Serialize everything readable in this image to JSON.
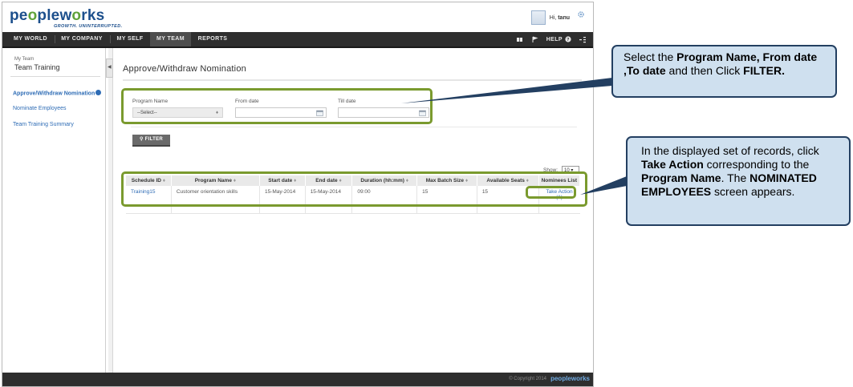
{
  "header": {
    "logo_text_left": "pe",
    "logo_text_o": "o",
    "logo_text_mid": "plew",
    "logo_text_o2": "o",
    "logo_text_right": "rks",
    "tagline": "GROWTH. UNINTERRUPTED.",
    "greeting_prefix": "Hi,",
    "user_name": "tanu"
  },
  "nav": {
    "items": [
      {
        "label": "MY WORLD"
      },
      {
        "label": "MY COMPANY"
      },
      {
        "label": "MY SELF"
      },
      {
        "label": "MY TEAM",
        "active": true
      },
      {
        "label": "REPORTS"
      }
    ],
    "help_label": "HELP"
  },
  "sidebar": {
    "crumb": "My Team",
    "title": "Team Training",
    "links": [
      {
        "label": "Approve/Withdraw Nomination",
        "active": true
      },
      {
        "label": "Nominate Employees"
      },
      {
        "label": "Team Training Summary"
      }
    ]
  },
  "main": {
    "title": "Approve/Withdraw Nomination",
    "filters": {
      "program_name_label": "Program Name",
      "program_name_value": "--Select--",
      "from_date_label": "From date",
      "till_date_label": "Till date",
      "filter_button": "FILTER"
    },
    "show_label": "Show:",
    "show_value": "10",
    "table": {
      "columns": [
        "Schedule ID",
        "Program Name",
        "Start date",
        "End date",
        "Duration (hh:mm)",
        "Max Batch Size",
        "Available Seats",
        "Nominees List"
      ],
      "rows": [
        {
          "schedule_id": "Training15",
          "program_name": "Customer orientation skills",
          "start_date": "15-May-2014",
          "end_date": "15-May-2014",
          "duration": "09:00",
          "max_batch": "15",
          "available_seats": "15",
          "nominees": "Take Action (1)"
        }
      ]
    }
  },
  "footer": {
    "copyright": "© Copyright 2014",
    "logo": "peopleworks"
  },
  "callouts": {
    "filter": {
      "t1": "Select the ",
      "b1": "Program Name, From date ,To date",
      "t2": " and then Click ",
      "b2": "FILTER."
    },
    "action": {
      "t1": "In the displayed set of records, click ",
      "b1": "Take Action",
      "t2": " corresponding to the ",
      "b2": "Program Name",
      "t3": ". The ",
      "b3": "NOMINATED EMPLOYEES",
      "t4": " screen appears."
    }
  },
  "colors": {
    "highlight": "#7a9a2e",
    "callout_fill": "#cfe0ef",
    "callout_border": "#233f61",
    "nav_bg": "#2e2e2e",
    "link": "#2e6cb5"
  }
}
